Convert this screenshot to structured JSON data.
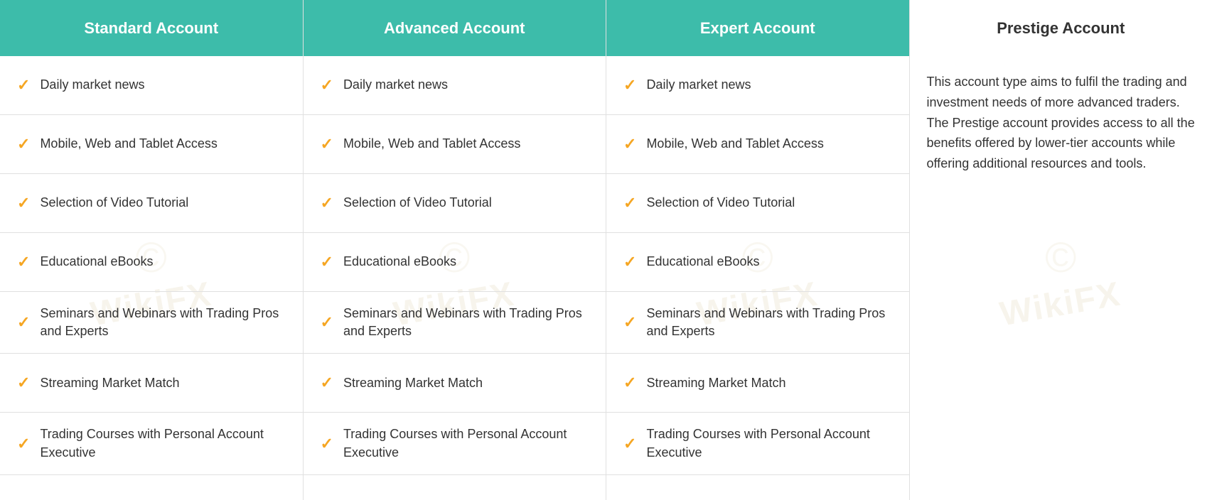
{
  "columns": [
    {
      "id": "standard",
      "header": "Standard Account",
      "type": "features",
      "features": [
        {
          "text": "Daily market news"
        },
        {
          "text": "Mobile, Web and Tablet Access"
        },
        {
          "text": "Selection of Video Tutorial"
        },
        {
          "text": "Educational eBooks"
        },
        {
          "text": "Seminars and Webinars with Trading Pros and Experts"
        },
        {
          "text": "Streaming Market Match"
        },
        {
          "text": "Trading Courses with Personal Account Executive"
        }
      ]
    },
    {
      "id": "advanced",
      "header": "Advanced Account",
      "type": "features",
      "features": [
        {
          "text": "Daily market news"
        },
        {
          "text": "Mobile, Web and Tablet Access"
        },
        {
          "text": "Selection of Video Tutorial"
        },
        {
          "text": "Educational eBooks"
        },
        {
          "text": "Seminars and Webinars with Trading Pros and Experts"
        },
        {
          "text": "Streaming Market Match"
        },
        {
          "text": "Trading Courses with Personal Account Executive"
        }
      ]
    },
    {
      "id": "expert",
      "header": "Expert Account",
      "type": "features",
      "features": [
        {
          "text": "Daily market news"
        },
        {
          "text": "Mobile, Web and Tablet Access"
        },
        {
          "text": "Selection of Video Tutorial"
        },
        {
          "text": "Educational eBooks"
        },
        {
          "text": "Seminars and Webinars with Trading Pros and Experts"
        },
        {
          "text": "Streaming Market Match"
        },
        {
          "text": "Trading Courses with Personal Account Executive"
        }
      ]
    },
    {
      "id": "prestige",
      "header": "Prestige Account",
      "type": "description",
      "description": "This account type aims to fulfil the trading and investment needs of more advanced traders. The Prestige account provides access to all the benefits offered by lower-tier accounts while offering additional resources and tools."
    }
  ],
  "checkmark": "✓",
  "watermark_text": "WikiFX",
  "accent_color": "#3dbcaa",
  "check_color": "#f5a623"
}
